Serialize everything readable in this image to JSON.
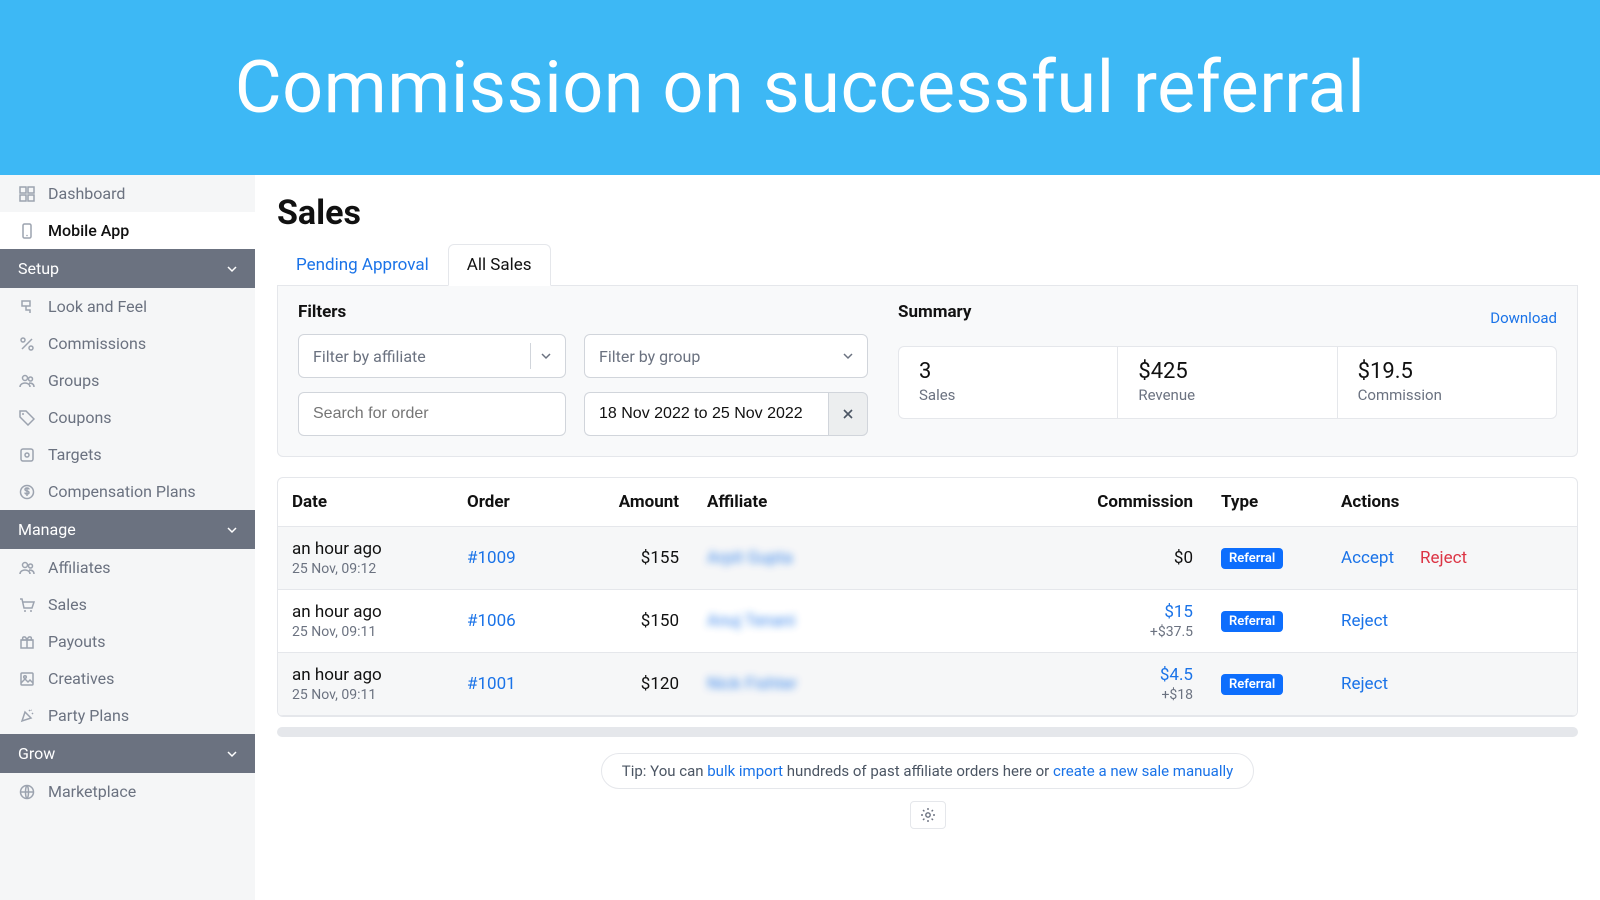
{
  "banner": "Commission on successful referral",
  "sidebar": {
    "items_top": [
      {
        "label": "Dashboard",
        "icon": "grid"
      },
      {
        "label": "Mobile App",
        "icon": "phone",
        "active": true
      }
    ],
    "group_setup": "Setup",
    "setup": [
      {
        "label": "Look and Feel",
        "icon": "paint"
      },
      {
        "label": "Commissions",
        "icon": "percent"
      },
      {
        "label": "Groups",
        "icon": "people"
      },
      {
        "label": "Coupons",
        "icon": "tag"
      },
      {
        "label": "Targets",
        "icon": "target"
      },
      {
        "label": "Compensation Plans",
        "icon": "dollar"
      }
    ],
    "group_manage": "Manage",
    "manage": [
      {
        "label": "Affiliates",
        "icon": "people"
      },
      {
        "label": "Sales",
        "icon": "cart"
      },
      {
        "label": "Payouts",
        "icon": "gift"
      },
      {
        "label": "Creatives",
        "icon": "image"
      },
      {
        "label": "Party Plans",
        "icon": "confetti"
      }
    ],
    "group_grow": "Grow",
    "grow": [
      {
        "label": "Marketplace",
        "icon": "globe"
      }
    ]
  },
  "page": {
    "title": "Sales",
    "tabs": {
      "pending": "Pending Approval",
      "all": "All Sales"
    }
  },
  "filters": {
    "heading": "Filters",
    "affiliate_placeholder": "Filter by affiliate",
    "group_placeholder": "Filter by group",
    "search_placeholder": "Search for order",
    "date_value": "18 Nov 2022 to 25 Nov 2022"
  },
  "summary": {
    "heading": "Summary",
    "download": "Download",
    "cards": [
      {
        "value": "3",
        "label": "Sales"
      },
      {
        "value": "$425",
        "label": "Revenue"
      },
      {
        "value": "$19.5",
        "label": "Commission"
      }
    ]
  },
  "table": {
    "headers": {
      "date": "Date",
      "order": "Order",
      "amount": "Amount",
      "affiliate": "Affiliate",
      "commission": "Commission",
      "type": "Type",
      "actions": "Actions"
    },
    "rows": [
      {
        "ago": "an hour ago",
        "ts": "25 Nov, 09:12",
        "order": "#1009",
        "amount": "$155",
        "affiliate": "Arpit Gupta",
        "commission": "$0",
        "commission_extra": "",
        "commission_link": false,
        "type": "Referral",
        "accept": "Accept",
        "reject": "Reject"
      },
      {
        "ago": "an hour ago",
        "ts": "25 Nov, 09:11",
        "order": "#1006",
        "amount": "$150",
        "affiliate": "Anuj Tenani",
        "commission": "$15",
        "commission_extra": "+$37.5",
        "commission_link": true,
        "type": "Referral",
        "accept": "",
        "reject": "Reject"
      },
      {
        "ago": "an hour ago",
        "ts": "25 Nov, 09:11",
        "order": "#1001",
        "amount": "$120",
        "affiliate": "Nick Fishter",
        "commission": "$4.5",
        "commission_extra": "+$18",
        "commission_link": true,
        "type": "Referral",
        "accept": "",
        "reject": "Reject"
      }
    ]
  },
  "tip": {
    "prefix": "Tip: You can ",
    "link1": "bulk import",
    "mid": " hundreds of past affiliate orders here or ",
    "link2": "create a new sale manually"
  }
}
